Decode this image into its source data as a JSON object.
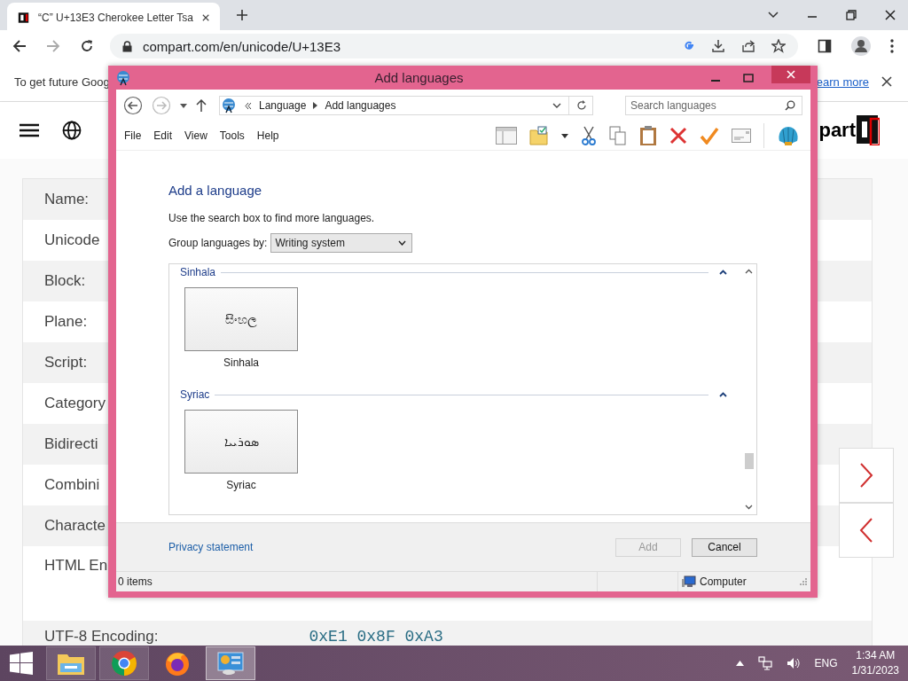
{
  "browser": {
    "tab": {
      "title": "“C” U+13E3 Cherokee Letter Tsa",
      "selected": true
    },
    "url": "compart.com/en/unicode/U+13E3",
    "infobar": {
      "text": "To get future Goog",
      "link": "earn more"
    },
    "site": {
      "logo_text": "part"
    },
    "rows": [
      {
        "label": "Name:"
      },
      {
        "label": "Unicode"
      },
      {
        "label": "Block:"
      },
      {
        "label": "Plane:"
      },
      {
        "label": "Script:"
      },
      {
        "label": "Category"
      },
      {
        "label": "Bidirecti"
      },
      {
        "label": "Combini"
      },
      {
        "label": "Characte"
      },
      {
        "label": "HTML En"
      }
    ],
    "utf8": {
      "label": "UTF-8 Encoding:",
      "value": "0xE1 0x8F 0xA3"
    }
  },
  "dialog": {
    "title": "Add languages",
    "breadcrumb": [
      "Language",
      "Add languages"
    ],
    "search": {
      "placeholder": "Search languages"
    },
    "menu": [
      "File",
      "Edit",
      "View",
      "Tools",
      "Help"
    ],
    "heading": "Add a language",
    "hint": "Use the search box to find more languages.",
    "group_by": {
      "label": "Group languages by:",
      "value": "Writing system"
    },
    "groups": [
      {
        "name": "Sinhala",
        "expanded": true,
        "items": [
          {
            "sample": "සිංහල",
            "name": "Sinhala",
            "selected": false
          }
        ]
      },
      {
        "name": "Syriac",
        "expanded": true,
        "items": [
          {
            "sample": "ܣܘܪܝܝܐ",
            "name": "Syriac",
            "selected": false
          }
        ]
      }
    ],
    "privacy": "Privacy statement",
    "buttons": [
      {
        "label": "Add",
        "disabled": true
      },
      {
        "label": "Cancel",
        "disabled": false
      }
    ],
    "status": {
      "items": "0 items",
      "zone": "Computer"
    }
  },
  "taskbar": {
    "apps": [
      {
        "kind": "explorer",
        "selected": false
      },
      {
        "kind": "chrome",
        "selected": false
      },
      {
        "kind": "firefox",
        "selected": false
      },
      {
        "kind": "control",
        "selected": true
      }
    ],
    "lang": "ENG",
    "time": "1:34 AM",
    "date": "1/31/2023"
  }
}
